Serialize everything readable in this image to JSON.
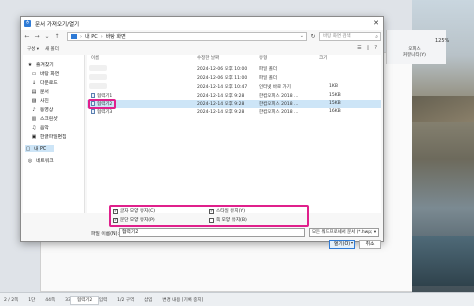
{
  "dialog": {
    "title": "문서 가져오기/열기",
    "close_glyph": "✕"
  },
  "nav": {
    "back": "←",
    "forward": "→",
    "down": "⌄",
    "up": "↑",
    "path": [
      "내 PC",
      "바탕 화면"
    ],
    "refresh": "↻",
    "search_placeholder": "바탕 화면 검색"
  },
  "toolbar": {
    "organize": "구성 ▾",
    "new_folder": "새 폴더"
  },
  "sidebar": {
    "items": [
      {
        "icon": "★",
        "label": "즐겨찾기"
      },
      {
        "icon": "▭",
        "label": "바탕 화면"
      },
      {
        "icon": "↓",
        "label": "다운로드"
      },
      {
        "icon": "▤",
        "label": "문서"
      },
      {
        "icon": "▨",
        "label": "사진"
      },
      {
        "icon": "♪",
        "label": "동영상"
      },
      {
        "icon": "▥",
        "label": "스크린샷"
      },
      {
        "icon": "♫",
        "label": "음악"
      },
      {
        "icon": "▣",
        "label": "한글파일편집"
      },
      {
        "icon": "▢",
        "label": "내 PC"
      },
      {
        "icon": "◎",
        "label": "네트워크"
      }
    ]
  },
  "files": {
    "headers": {
      "name": "이름",
      "date": "수정한 날짜",
      "type": "유형",
      "size": "크기"
    },
    "rows": [
      {
        "name": "",
        "date": "2024-12-06 오후 10:00",
        "type": "파일 폴더",
        "size": ""
      },
      {
        "name": "",
        "date": "2024-12-06 오후 11:00",
        "type": "파일 폴더",
        "size": ""
      },
      {
        "name": "",
        "date": "2024-12-14 오후 10:47",
        "type": "인터넷 바로 가기",
        "size": "1KB"
      },
      {
        "name": "협력기1",
        "date": "2024-12-14 오후 9:28",
        "type": "한컴오피스 2018 ...",
        "size": "15KB"
      },
      {
        "name": "협력기2",
        "date": "2024-12-14 오후 9:28",
        "type": "한컴오피스 2018 ...",
        "size": "15KB"
      },
      {
        "name": "협력기3",
        "date": "2024-12-14 오후 9:28",
        "type": "한컴오피스 2018 ...",
        "size": "16KB"
      }
    ]
  },
  "options": {
    "keep_char": "글자 모양 유지(C)",
    "keep_style": "스타일 유지(Y)",
    "keep_para": "문단 모양 유지(P)",
    "keep_page": "쪽 모양 유지(B)"
  },
  "footer": {
    "filename_label": "파일 이름(N):",
    "filename_value": "협력기2",
    "filetype_value": "모든 워드프로세서 문서 (*.hwp; ▾",
    "open_button": "열기(O)",
    "open_drop": "▾",
    "cancel_button": "취소"
  },
  "app": {
    "ribbon": [
      "오피스",
      "커뮤니티(Y)"
    ],
    "zoom": "125%",
    "tab": "협력기2",
    "status": [
      "2 / 2쪽",
      "1단",
      "44쪽",
      "33글자",
      "문자 입력",
      "1/2 구역",
      "삽입",
      "변경 내용 [기록 중지]"
    ]
  },
  "colors": {
    "accent": "#2f7bd6",
    "highlight": "#e0208c",
    "selection": "#cde5f7"
  }
}
